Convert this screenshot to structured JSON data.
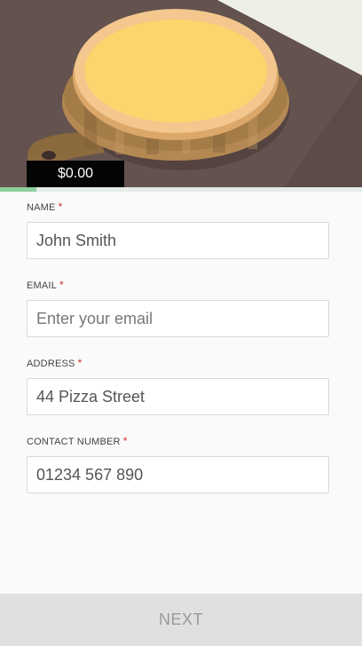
{
  "order": {
    "price": "$0.00",
    "progress": 0.1
  },
  "form": {
    "required_marker": "*",
    "name": {
      "label": "NAME",
      "value": "John Smith",
      "placeholder": ""
    },
    "email": {
      "label": "EMAIL",
      "value": "",
      "placeholder": "Enter your email"
    },
    "address": {
      "label": "ADDRESS",
      "value": "44 Pizza Street",
      "placeholder": ""
    },
    "contact": {
      "label": "CONTACT NUMBER",
      "value": "01234 567 890",
      "placeholder": ""
    }
  },
  "footer": {
    "next_label": "NEXT"
  },
  "colors": {
    "progress": "#8fcf9d",
    "required": "#d32f2f",
    "cheese": "#fad66d",
    "crust": "#f3c78d",
    "board": "#a47c48"
  }
}
